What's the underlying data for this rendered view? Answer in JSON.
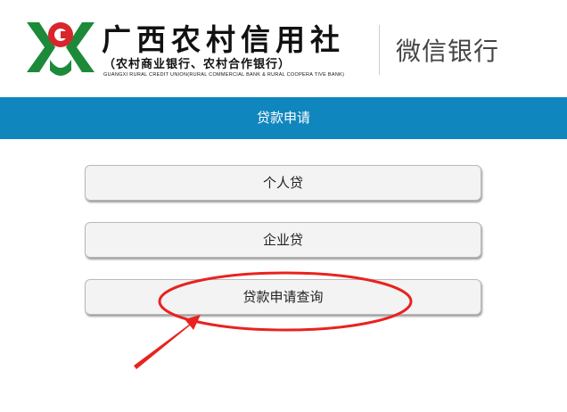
{
  "header": {
    "brand_name": "广西农村信用社",
    "brand_subtitle": "（农村商业银行、农村合作银行）",
    "brand_english": "GUANGXI RURAL CREDIT UNION(RURAL COMMERCIAL BANK & RURAL COOPERA TIVE BANK)",
    "service_name": "微信银行",
    "logo_icon": "rural-credit-logo-icon"
  },
  "page": {
    "title": "贷款申请"
  },
  "menu": {
    "personal_loan": "个人贷",
    "business_loan": "企业贷",
    "application_query": "贷款申请查询"
  },
  "colors": {
    "title_bar": "#1086bf",
    "logo_green": "#1d8a3a",
    "logo_red": "#d8262c",
    "annotation_red": "#e8231f"
  }
}
